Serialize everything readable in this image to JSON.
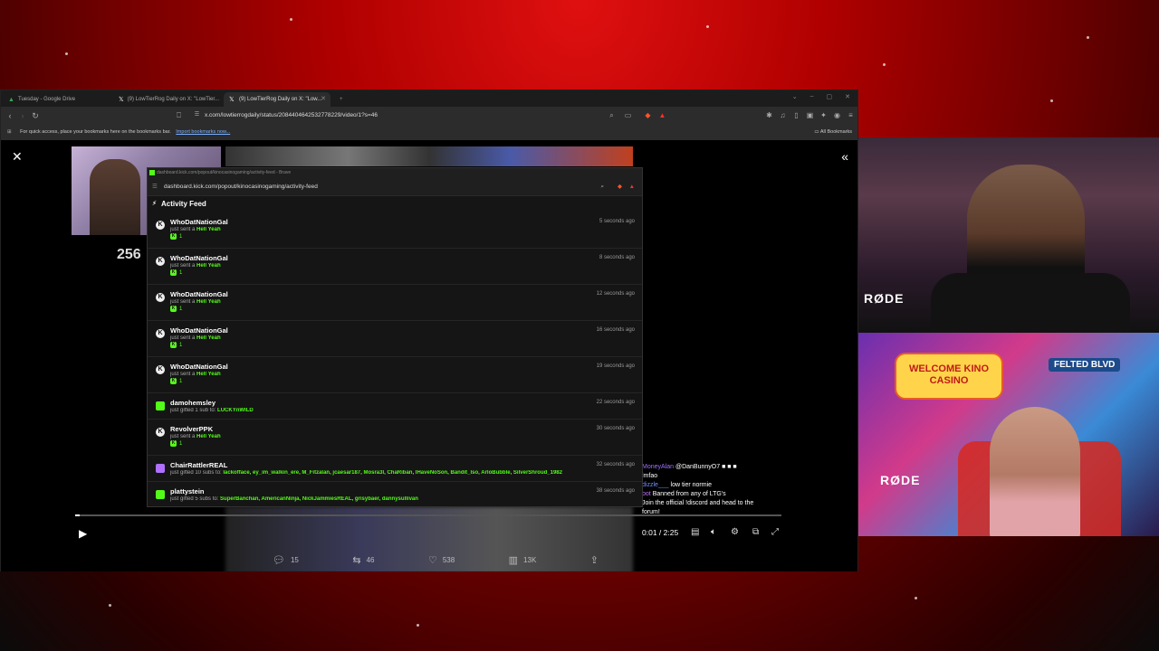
{
  "tabs": [
    {
      "label": "Tuesday - Google Drive",
      "icon": "google-drive-icon"
    },
    {
      "label": "(9) LowTierRog Daily on X: \"LowTier...",
      "icon": "x-icon"
    },
    {
      "label": "(9) LowTierRog Daily on X: \"Low...",
      "icon": "x-icon"
    }
  ],
  "address": {
    "url": "x.com/lowtierrogdaily/status/2084404642532778229/video/1?s=46"
  },
  "bookmarks": {
    "hint": "For quick access, place your bookmarks here on the bookmarks bar.",
    "import_link": "Import bookmarks now...",
    "all": "All Bookmarks"
  },
  "video": {
    "overlay_number": "256",
    "time": "0:01 / 2:25",
    "progress": 0.007
  },
  "post_actions": {
    "replies": "15",
    "reposts": "46",
    "likes": "538",
    "views": "13K"
  },
  "chat": [
    {
      "user": "MoneyAlan",
      "text": "@DanBunnyO7 ■ ■ ■"
    },
    {
      "user": "",
      "text": "lmfao"
    },
    {
      "user": "dizzle___",
      "text": "low tier normie"
    },
    {
      "user": "bot",
      "text": "Banned from any of LTG's"
    },
    {
      "user": "",
      "text": "Join the official !discord and head to the"
    },
    {
      "user": "",
      "text": "forum!"
    }
  ],
  "popup": {
    "window_title": "dashboard.kick.com/popout/kinocasinogaming/activity-feed - Brave",
    "url": "dashboard.kick.com/popout/kinocasinogaming/activity-feed",
    "header": "Activity Feed",
    "items": [
      {
        "name": "WhoDatNationGal",
        "prefix": "just sent a",
        "highlight": "Hell Yeah",
        "count": "1",
        "time": "5 seconds ago",
        "kind": "kick"
      },
      {
        "name": "WhoDatNationGal",
        "prefix": "just sent a",
        "highlight": "Hell Yeah",
        "count": "1",
        "time": "8 seconds ago",
        "kind": "kick"
      },
      {
        "name": "WhoDatNationGal",
        "prefix": "just sent a",
        "highlight": "Hell Yeah",
        "count": "1",
        "time": "12 seconds ago",
        "kind": "kick"
      },
      {
        "name": "WhoDatNationGal",
        "prefix": "just sent a",
        "highlight": "Hell Yeah",
        "count": "1",
        "time": "16 seconds ago",
        "kind": "kick"
      },
      {
        "name": "WhoDatNationGal",
        "prefix": "just sent a",
        "highlight": "Hell Yeah",
        "count": "1",
        "time": "19 seconds ago",
        "kind": "kick"
      },
      {
        "name": "damohemsley",
        "prefix": "just gifted 1 sub to:",
        "highlight": "LUCKYnWILD",
        "count": "",
        "time": "22 seconds ago",
        "kind": "gift"
      },
      {
        "name": "RevolverPPK",
        "prefix": "just sent a",
        "highlight": "Hell Yeah",
        "count": "1",
        "time": "30 seconds ago",
        "kind": "kick"
      },
      {
        "name": "ChairRattlerREAL",
        "prefix": "just gifted 10 subs to:",
        "highlight": "lackofface, ey_im_walkin_ere, M_Fitzalan, jcaesar187, Mosra3l, ChaRiban, IHaveNoSon, Bandit_lso, ArloBubble, SilverShroud_1982",
        "count": "",
        "time": "32 seconds ago",
        "kind": "gift-purple"
      },
      {
        "name": "plattystein",
        "prefix": "just gifted 5 subs to:",
        "highlight": "SuperBanchan, AmericanNinja, NickJammiesREAL, grisybaer, dannysullivan",
        "count": "",
        "time": "38 seconds ago",
        "kind": "gift"
      }
    ]
  },
  "cams": {
    "sign": "WELCOME KINO CASINO",
    "felted": "FELTED BLVD",
    "rode": "RØDE"
  }
}
